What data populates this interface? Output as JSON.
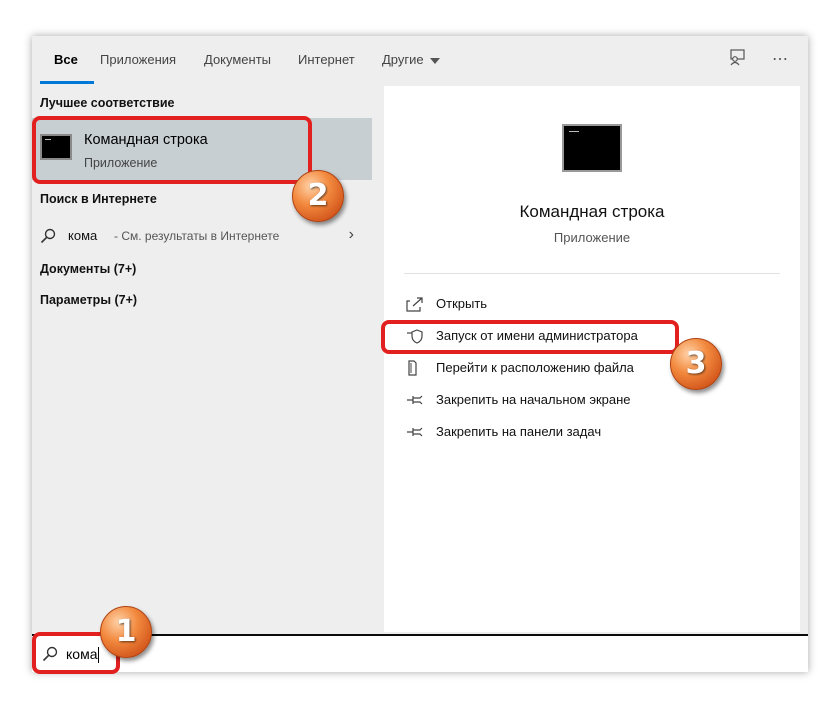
{
  "tabs": [
    {
      "label": "Все"
    },
    {
      "label": "Приложения"
    },
    {
      "label": "Документы"
    },
    {
      "label": "Интернет"
    },
    {
      "label": "Другие"
    }
  ],
  "top_icons": [
    "feedback-icon",
    "more-options-icon"
  ],
  "left": {
    "best_match_header": "Лучшее соответствие",
    "best_match": {
      "title": "Командная строка",
      "subtitle": "Приложение"
    },
    "web_header": "Поиск в Интернете",
    "web_query": "кома",
    "web_hint": "- См. результаты в Интернете",
    "documents": "Документы (7+)",
    "settings": "Параметры (7+)"
  },
  "right": {
    "app_title": "Командная строка",
    "app_type": "Приложение",
    "actions": [
      {
        "label": "Открыть",
        "icon": "open-icon"
      },
      {
        "label": "Запуск от имени администратора",
        "icon": "shield-icon"
      },
      {
        "label": "Перейти к расположению файла",
        "icon": "file-location-icon"
      },
      {
        "label": "Закрепить на начальном экране",
        "icon": "pin-icon"
      },
      {
        "label": "Закрепить на панели задач",
        "icon": "pin-icon"
      }
    ]
  },
  "search": {
    "value": "кома"
  },
  "callouts": [
    "1",
    "2",
    "3"
  ],
  "colors": {
    "accent": "#0078d7",
    "highlight": "#e32020",
    "selected": "#c7cfd2"
  }
}
